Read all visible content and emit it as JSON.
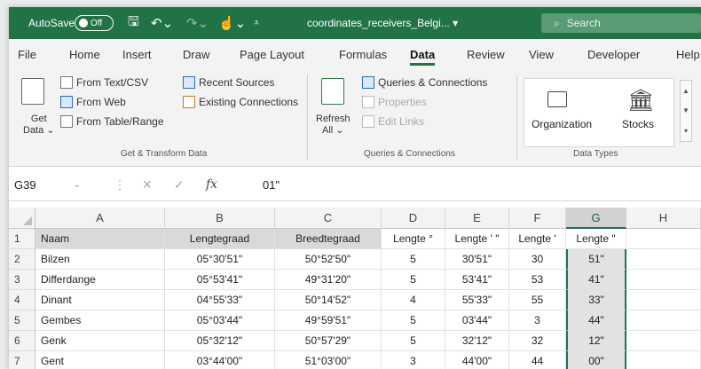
{
  "titlebar": {
    "autosave_label": "AutoSave",
    "autosave_state": "Off",
    "filename": "coordinates_receivers_Belgi...",
    "search_placeholder": "Search"
  },
  "tabs": [
    "File",
    "Home",
    "Insert",
    "Draw",
    "Page Layout",
    "Formulas",
    "Data",
    "Review",
    "View",
    "Developer",
    "Help"
  ],
  "active_tab": "Data",
  "ribbon": {
    "get_data": {
      "line1": "Get",
      "line2": "Data ⌄"
    },
    "from_text_csv": "From Text/CSV",
    "from_web": "From Web",
    "from_table_range": "From Table/Range",
    "recent_sources": "Recent Sources",
    "existing_connections": "Existing Connections",
    "group1_label": "Get & Transform Data",
    "refresh": {
      "line1": "Refresh",
      "line2": "All ⌄"
    },
    "queries_connections": "Queries & Connections",
    "properties": "Properties",
    "edit_links": "Edit Links",
    "group2_label": "Queries & Connections",
    "organization": "Organization",
    "stocks": "Stocks",
    "group3_label": "Data Types"
  },
  "formula_bar": {
    "name_box": "G39",
    "formula": "01\""
  },
  "columns": [
    "A",
    "B",
    "C",
    "D",
    "E",
    "F",
    "G",
    "H"
  ],
  "selected_column": "G",
  "rows": [
    {
      "num": "1",
      "cells": [
        "Naam",
        "Lengtegraad",
        "Breedtegraad",
        "Lengte °",
        "Lengte ' \"",
        "Lengte '",
        "Lengte \"",
        ""
      ]
    },
    {
      "num": "2",
      "cells": [
        "Bilzen",
        "05°30'51\"",
        "50°52'50\"",
        "5",
        "30'51\"",
        "30",
        "51\"",
        ""
      ]
    },
    {
      "num": "3",
      "cells": [
        "Differdange",
        "05°53'41\"",
        "49°31'20\"",
        "5",
        "53'41\"",
        "53",
        "41\"",
        ""
      ]
    },
    {
      "num": "4",
      "cells": [
        "Dinant",
        "04°55'33\"",
        "50°14'52\"",
        "4",
        "55'33\"",
        "55",
        "33\"",
        ""
      ]
    },
    {
      "num": "5",
      "cells": [
        "Gembes",
        "05°03'44\"",
        "49°59'51\"",
        "5",
        "03'44\"",
        "3",
        "44\"",
        ""
      ]
    },
    {
      "num": "6",
      "cells": [
        "Genk",
        "05°32'12\"",
        "50°57'29\"",
        "5",
        "32'12\"",
        "32",
        "12\"",
        ""
      ]
    },
    {
      "num": "7",
      "cells": [
        "Gent",
        "03°44'00\"",
        "51°03'00\"",
        "3",
        "44'00\"",
        "44",
        "00\"",
        ""
      ]
    }
  ]
}
